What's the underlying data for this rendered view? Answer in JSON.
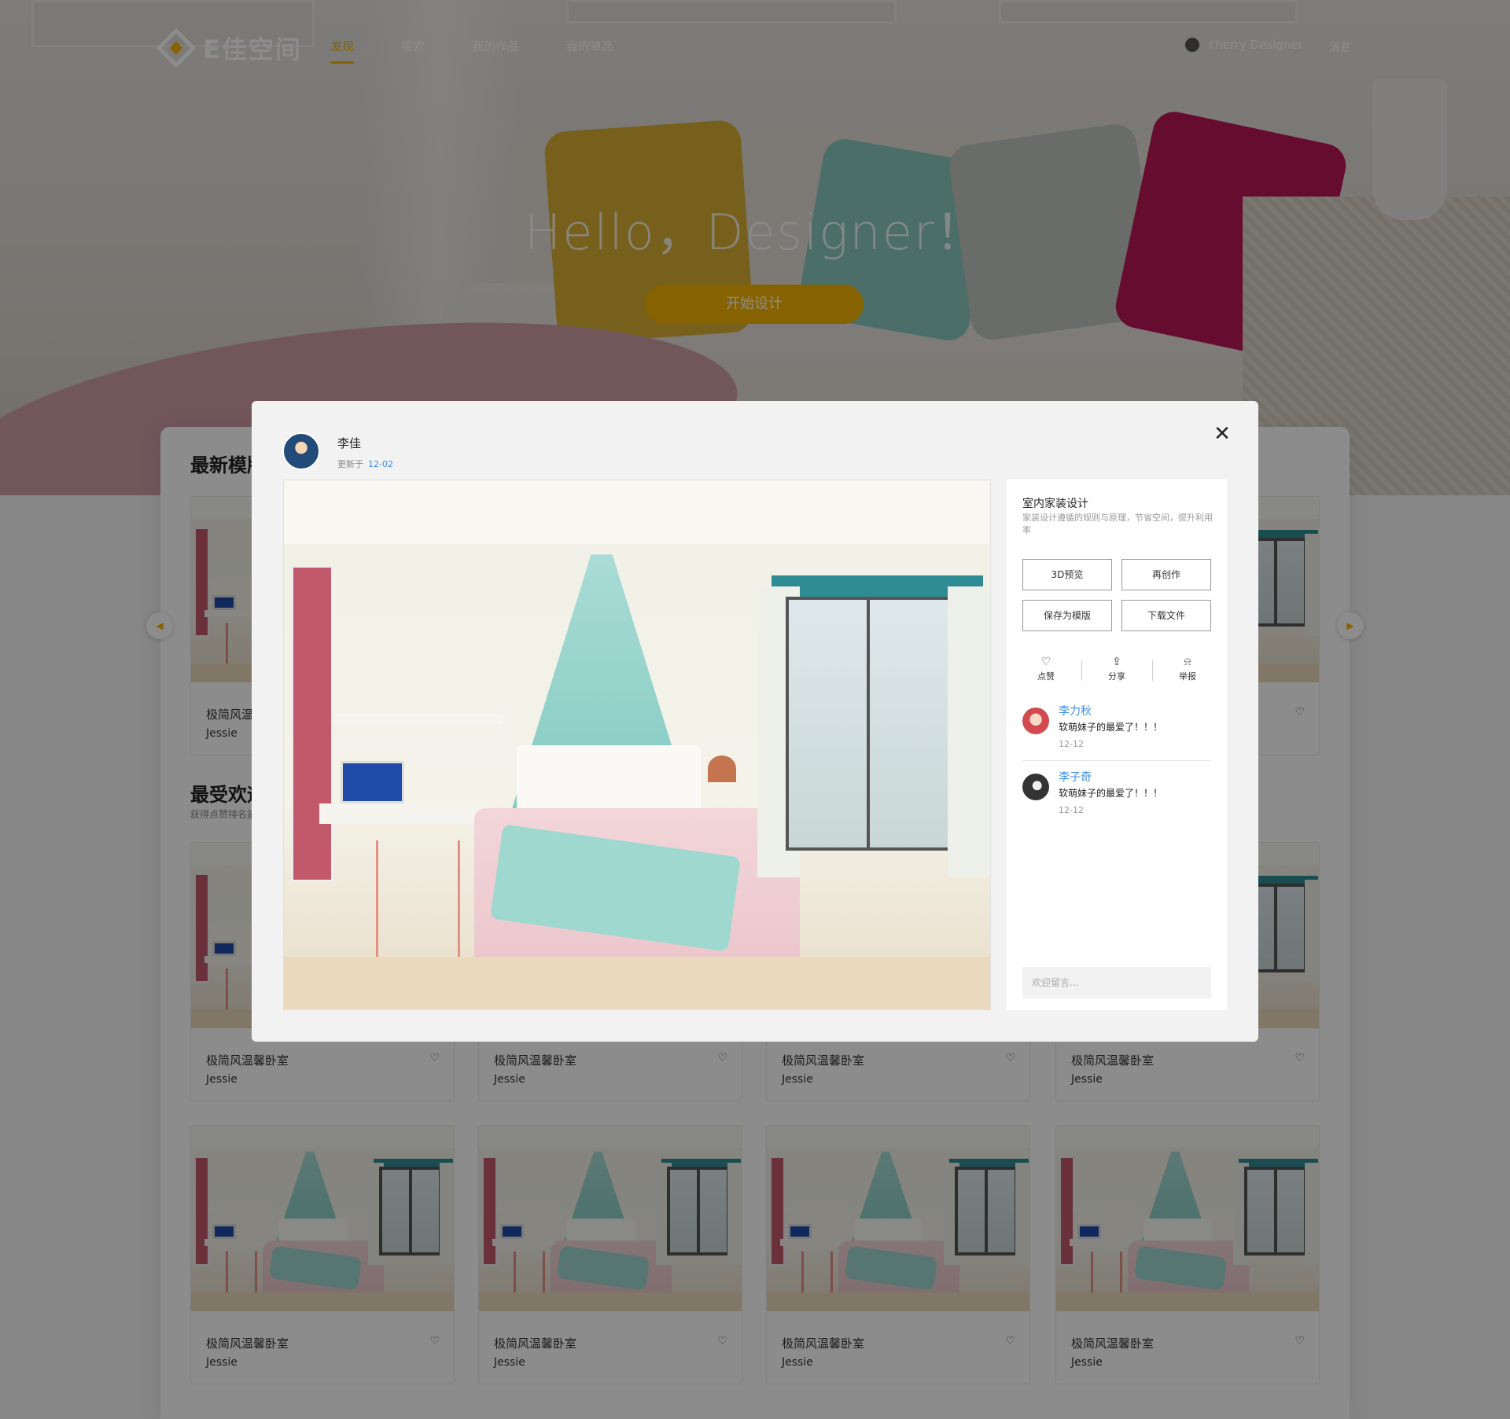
{
  "brand": {
    "name": "E佳空间"
  },
  "nav": {
    "items": [
      {
        "label": "发现",
        "active": true
      },
      {
        "label": "搜索",
        "active": false
      },
      {
        "label": "我的作品",
        "active": false
      },
      {
        "label": "我的单品",
        "active": false
      }
    ],
    "user_name": "cherry Designer",
    "more": "消息"
  },
  "hero": {
    "title": "Hello，Designer！",
    "button": "开始设计"
  },
  "sections": {
    "latest": {
      "title": "最新模版"
    },
    "popular": {
      "title": "最受欢迎",
      "subtitle": "获得点赞排名前"
    }
  },
  "cards": {
    "title": "极简风温馨卧室",
    "author": "Jessie",
    "like_icon": "heart-icon"
  },
  "modal": {
    "author": "李佳",
    "updated_label": "更新于",
    "updated_date": "12-02",
    "side": {
      "title": "室内家装设计",
      "desc": "家装设计遵循的规则与原理，节省空间，提升利用率",
      "buttons": [
        "3D预览",
        "再创作",
        "保存为模版",
        "下载文件"
      ],
      "actions": [
        {
          "label": "点赞",
          "icon": "heart-icon"
        },
        {
          "label": "分享",
          "icon": "share-icon"
        },
        {
          "label": "举报",
          "icon": "alarm-icon"
        }
      ]
    },
    "comments": [
      {
        "user": "李力秋",
        "text": "软萌妹子的最爱了！！！",
        "time": "12-12"
      },
      {
        "user": "李子奇",
        "text": "软萌妹子的最爱了！！！",
        "time": "12-12"
      }
    ],
    "comment_placeholder": "欢迎留言..."
  },
  "colors": {
    "accent": "#f5b400",
    "link": "#3b8ee0",
    "canopy": "#7cc7bd",
    "bedding": "#e9c2c8"
  }
}
